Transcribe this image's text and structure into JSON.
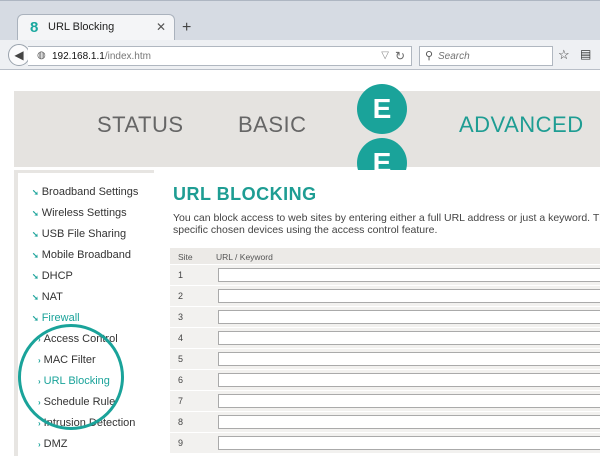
{
  "browser": {
    "tab_title": "URL Blocking",
    "tab_favicon": "8",
    "url_host": "192.168.1.1",
    "url_path": "/index.htm",
    "search_placeholder": "Search"
  },
  "header": {
    "nav": [
      {
        "label": "STATUS",
        "active": false
      },
      {
        "label": "BASIC",
        "active": false
      },
      {
        "label": "ADVANCED",
        "active": true
      }
    ],
    "logo_letters": [
      "E",
      "E"
    ]
  },
  "sidebar": {
    "items": [
      {
        "label": "Broadband Settings"
      },
      {
        "label": "Wireless Settings"
      },
      {
        "label": "USB File Sharing"
      },
      {
        "label": "Mobile Broadband"
      },
      {
        "label": "DHCP"
      },
      {
        "label": "NAT"
      },
      {
        "label": "Firewall",
        "active": true
      }
    ],
    "sub_items": [
      {
        "label": "Access Control"
      },
      {
        "label": "MAC Filter"
      },
      {
        "label": "URL Blocking",
        "active": true
      },
      {
        "label": "Schedule Rule"
      },
      {
        "label": "Intrusion Detection"
      },
      {
        "label": "DMZ"
      }
    ]
  },
  "main": {
    "title": "URL BLOCKING",
    "description": "You can block access to web sites by entering either a full URL address or just a keyword. The specific chosen devices using the access control feature.",
    "table": {
      "col_site": "Site",
      "col_url": "URL / Keyword",
      "rows": [
        "1",
        "2",
        "3",
        "4",
        "5",
        "6",
        "7",
        "8",
        "9"
      ]
    }
  },
  "colors": {
    "brand": "#1aa39a"
  }
}
